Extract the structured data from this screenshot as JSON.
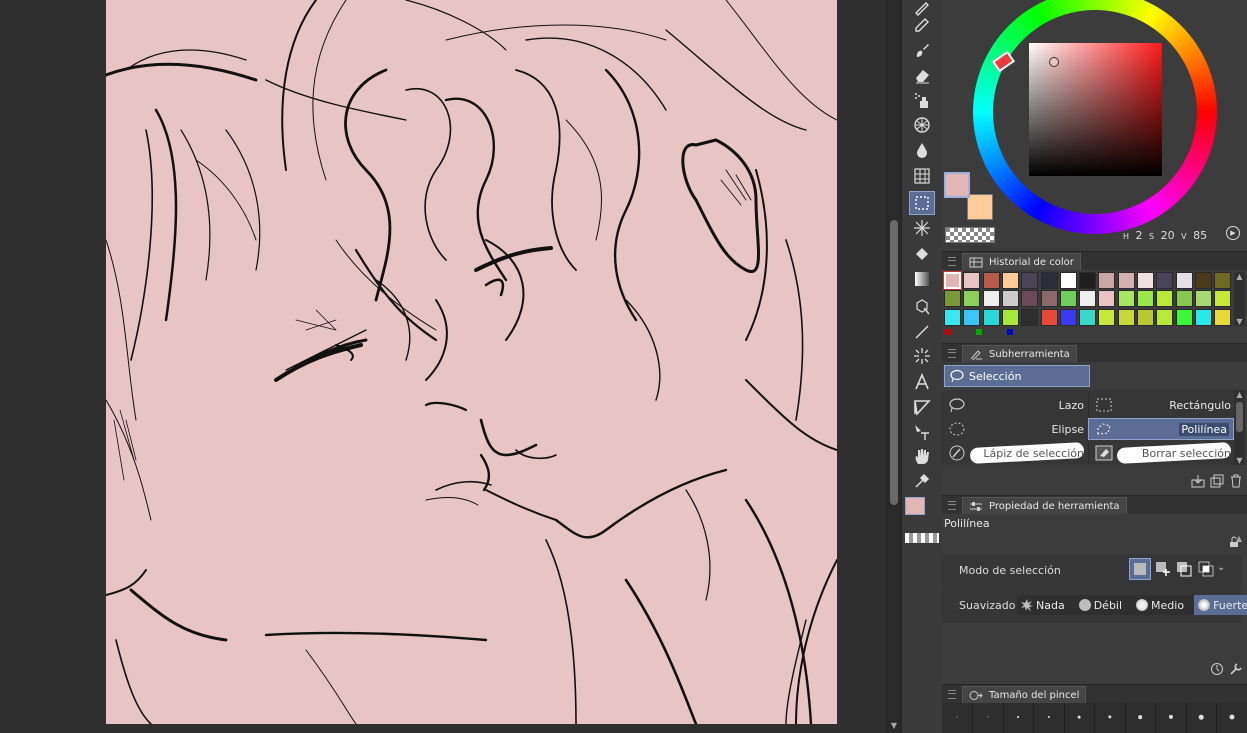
{
  "color_panel": {
    "main_color": "#e3b6b6",
    "sub_color": "#ffcc99",
    "readout": {
      "hue": "2",
      "saturation": "20",
      "value": "85"
    },
    "readout_labels": {
      "hue": "H",
      "saturation": "S",
      "value": "V"
    }
  },
  "color_history": {
    "title": "Historial de color",
    "swatches": [
      "#e3b6b6",
      "#e8c4c5",
      "#b85a4a",
      "#ffcc99",
      "#4a4458",
      "#2c2c3a",
      "#ffffff",
      "#1f1f1f",
      "#c9a7a7",
      "#d4b0b0",
      "#f0e0e0",
      "#4a4458",
      "#e8e0e8",
      "#4a3a1a",
      "#6e6a20",
      "#7a9a3a",
      "#8ccf5a",
      "#eeeeee",
      "#cccccc",
      "#6b4a5a",
      "#8a6a6a",
      "#6ecf5a",
      "#eeeeee",
      "#e8c4c5",
      "#a8e860",
      "#98e848",
      "#b8e838",
      "#88c850",
      "#a8d870",
      "#c8e838",
      "#38e8f0",
      "#38c8f8",
      "#2ad8d8",
      "#a8e838",
      "#2e2e2e",
      "#e84a3a",
      "#3a3af0",
      "#3ad8c8",
      "#c8e838",
      "#c8d838",
      "#b8c830",
      "#b8e838",
      "#38f838",
      "#28e8e8",
      "#e8d838"
    ]
  },
  "subtool_panel": {
    "title": "Subherramienta",
    "group_label": "Selección",
    "items": [
      "Lazo",
      "Rectángulo",
      "Elipse",
      "Polilínea",
      "Lápiz de selección",
      "Borrar selección"
    ]
  },
  "tool_property": {
    "title": "Propiedad de herramienta",
    "tool_name": "Polilínea",
    "selection_mode_label": "Modo de selección",
    "smoothing_label": "Suavizado",
    "smoothing_options": [
      "Nada",
      "Débil",
      "Medio",
      "Fuerte"
    ],
    "smoothing_selected": "Fuerte"
  },
  "brush_size_panel": {
    "title": "Tamaño del pincel"
  },
  "toolbar": {
    "tools": [
      "pen-icon",
      "pencil-icon",
      "brush-icon",
      "eraser-icon",
      "airbrush-icon",
      "decoration-icon",
      "blend-icon",
      "grid-icon",
      "selection-icon",
      "auto-select-icon",
      "fill-icon",
      "gradient-icon",
      "3d-operation-icon",
      "line-icon",
      "figure-icon",
      "text-icon",
      "frame-border-icon",
      "balloon-icon",
      "hand-icon",
      "eyedropper-icon"
    ],
    "active_tool": "selection-icon"
  },
  "colors": {
    "canvas_bg": "#e8c4c5",
    "accent": "#5b6d95",
    "panel_bg": "#3c3c3c"
  }
}
